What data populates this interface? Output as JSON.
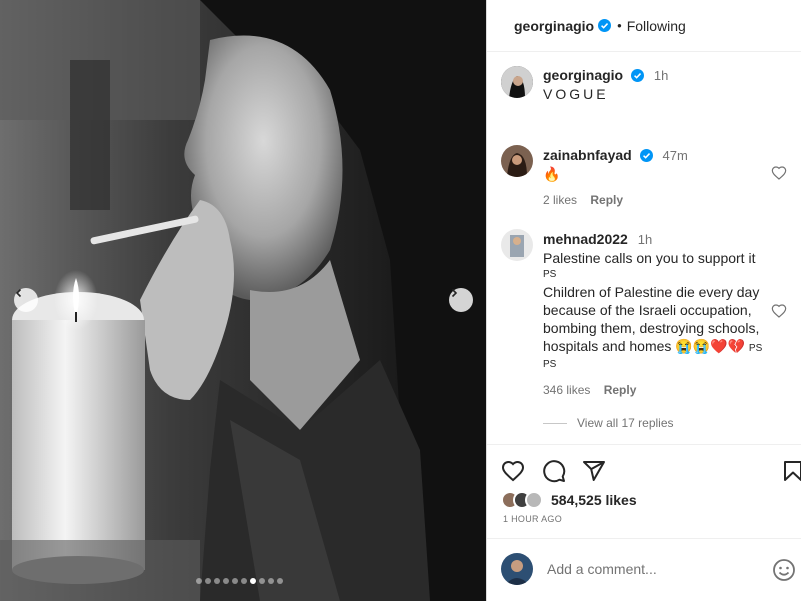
{
  "header": {
    "username": "georginagio",
    "bullet": "•",
    "follow_status": "Following"
  },
  "caption": {
    "username": "georginagio",
    "time": "1h",
    "text": "VOGUE"
  },
  "comments": [
    {
      "username": "zainabnfayad",
      "time": "47m",
      "text": "🔥",
      "likes": "2 likes",
      "reply_label": "Reply"
    },
    {
      "username": "mehnad2022",
      "time": "1h",
      "line1": "Palestine calls on you to support it",
      "ps1": "PS",
      "body": "Children of Palestine die every day because of the Israeli occupation, bombing them, destroying schools, hospitals and homes 😭😭❤️💔",
      "ps_inline": "PS",
      "ps2": "PS",
      "likes": "346 likes",
      "reply_label": "Reply"
    }
  ],
  "view_replies": "View all 17 replies",
  "actions": {
    "like_icon": "heart-icon",
    "comment_icon": "comment-icon",
    "share_icon": "share-icon",
    "save_icon": "bookmark-icon"
  },
  "likes_count": "584,525 likes",
  "post_time": "1 HOUR AGO",
  "add_comment_placeholder": "Add a comment...",
  "carousel": {
    "total_slides": 10,
    "active_index": 6
  },
  "colors": {
    "verified": "#0095f6",
    "text": "#262626",
    "muted": "#737373"
  }
}
